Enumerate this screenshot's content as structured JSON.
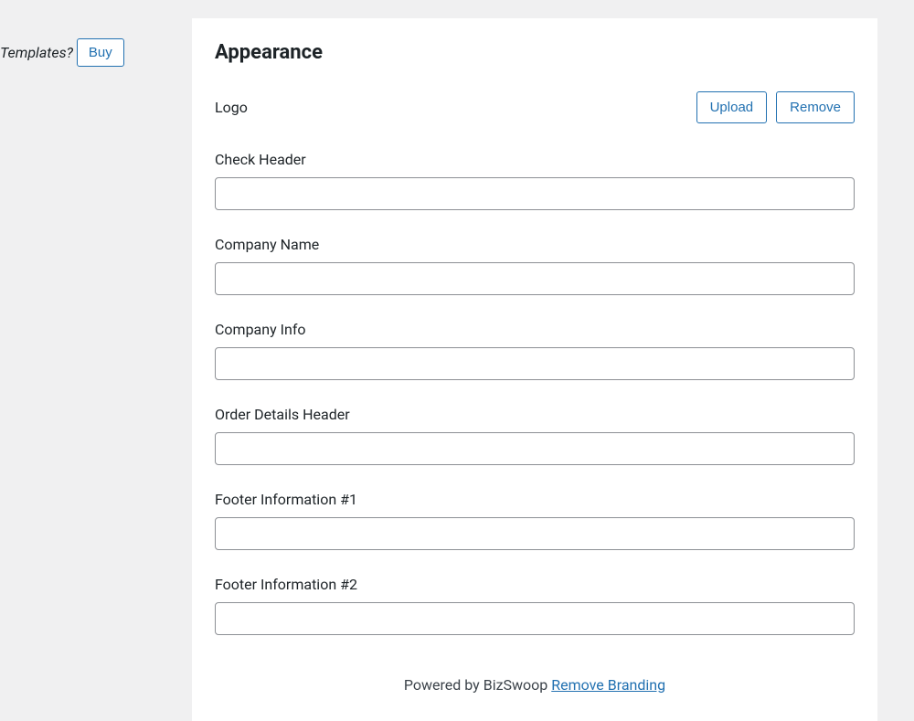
{
  "sidebar": {
    "templates_text": "Templates?",
    "buy_label": "Buy"
  },
  "appearance": {
    "title": "Appearance",
    "logo_label": "Logo",
    "upload_label": "Upload",
    "remove_label": "Remove",
    "fields": {
      "check_header_label": "Check Header",
      "check_header_value": "",
      "company_name_label": "Company Name",
      "company_name_value": "",
      "company_info_label": "Company Info",
      "company_info_value": "",
      "order_details_header_label": "Order Details Header",
      "order_details_header_value": "",
      "footer_info_1_label": "Footer Information #1",
      "footer_info_1_value": "",
      "footer_info_2_label": "Footer Information #2",
      "footer_info_2_value": ""
    }
  },
  "footer": {
    "powered_by": "Powered by BizSwoop ",
    "remove_branding": "Remove Branding"
  }
}
